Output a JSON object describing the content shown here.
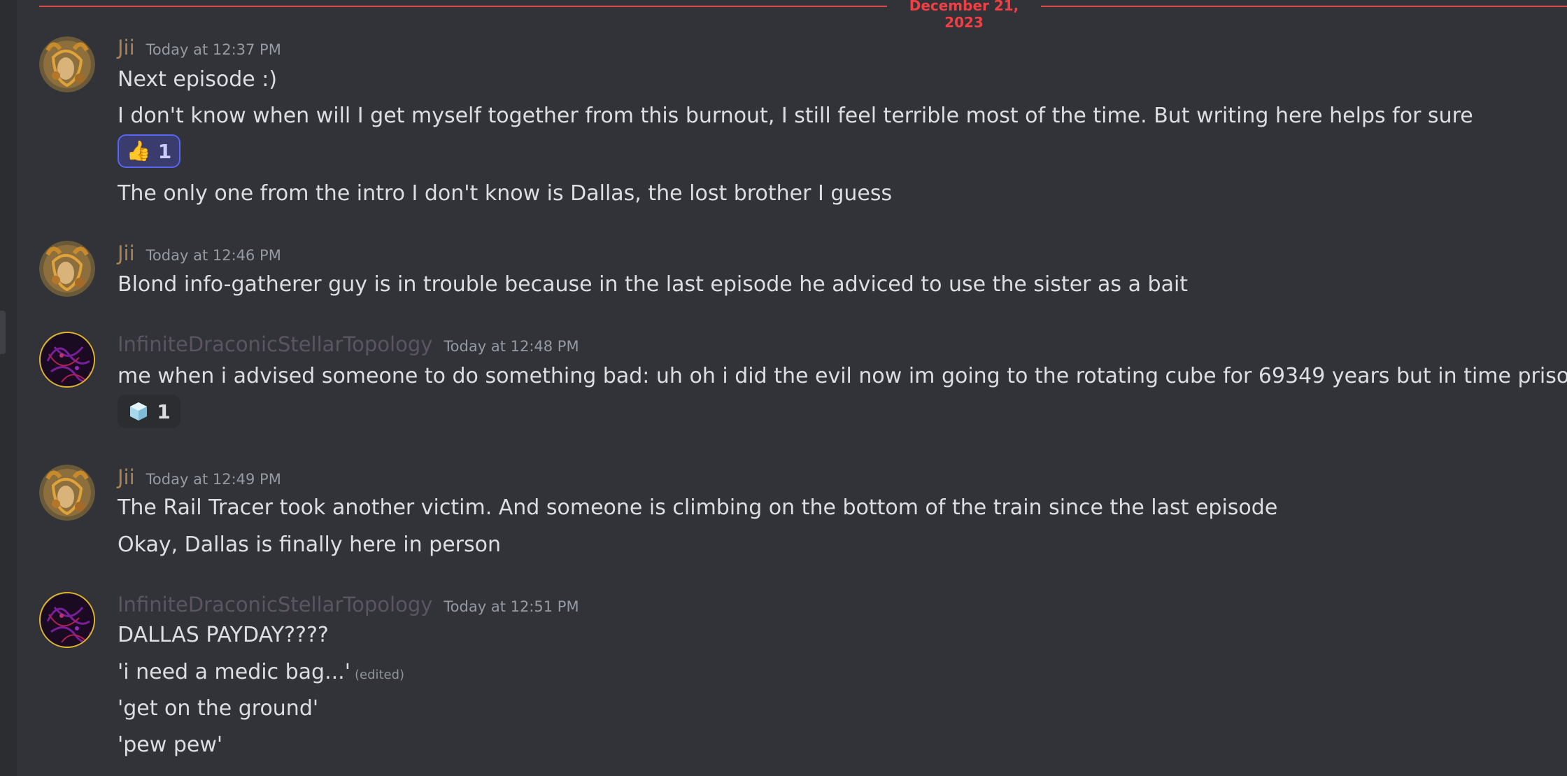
{
  "divider": {
    "date": "December 21, 2023"
  },
  "groups": [
    {
      "author": "Jii",
      "time": "Today at 12:37 PM",
      "lines": [
        "Next episode :)",
        "I don't know when will I get myself together from this burnout, I still feel terrible most of the time. But writing here helps for sure"
      ],
      "reaction": {
        "emoji": "👍",
        "count": "1"
      },
      "lines_after": [
        "The only one from the intro I don't know is Dallas, the lost brother I guess"
      ]
    },
    {
      "author": "Jii",
      "time": "Today at 12:46 PM",
      "lines": [
        "Blond info-gatherer guy is in trouble because in the last episode he adviced to use the sister as a bait"
      ]
    },
    {
      "author": "InfiniteDraconicStellarTopology",
      "time": "Today at 12:48 PM",
      "lines": [
        "me when i advised someone to do something bad: uh oh i did the evil now im going to the rotating cube for 69349 years but in time prison scale"
      ],
      "reaction": {
        "emoji": "ice-cube",
        "count": "1"
      }
    },
    {
      "author": "Jii",
      "time": "Today at 12:49 PM",
      "lines": [
        "The Rail Tracer took another victim. And someone is climbing on the bottom of the train since the last episode",
        "Okay, Dallas is finally here in person"
      ]
    },
    {
      "author": "InfiniteDraconicStellarTopology",
      "time": "Today at 12:51 PM",
      "lines": [
        "DALLAS PAYDAY????",
        "'i need a medic bag...'",
        "'get on the ground'",
        "'pew pew'"
      ],
      "edited_label": "(edited)"
    }
  ],
  "colors": {
    "background": "#313338",
    "divider": "#f23f43",
    "jii_name": "#a78358",
    "ids_name": "#5b5561",
    "reaction_active_border": "#5865f2"
  }
}
